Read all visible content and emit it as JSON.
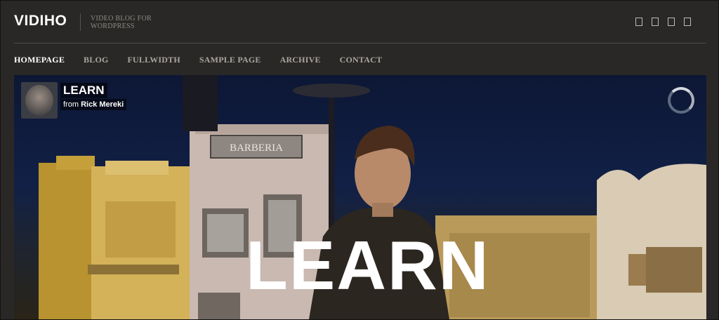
{
  "header": {
    "logo": "VIDIHO",
    "tagline": "VIDEO BLOG FOR WORDPRESS",
    "social_icons": [
      "social-icon-1",
      "social-icon-2",
      "social-icon-3",
      "social-icon-4"
    ]
  },
  "nav": {
    "items": [
      "HOMEPAGE",
      "BLOG",
      "FULLWIDTH",
      "SAMPLE PAGE",
      "ARCHIVE",
      "CONTACT"
    ],
    "active": "HOMEPAGE"
  },
  "video": {
    "title": "LEARN",
    "byline_from": "from",
    "author": "Rick Mereki",
    "overlay_text": "LEARN",
    "sign_text": "BARBERIA"
  },
  "colors": {
    "background": "#2a2826",
    "nav_active": "#ffffff",
    "nav_inactive": "#a9a6a1"
  }
}
